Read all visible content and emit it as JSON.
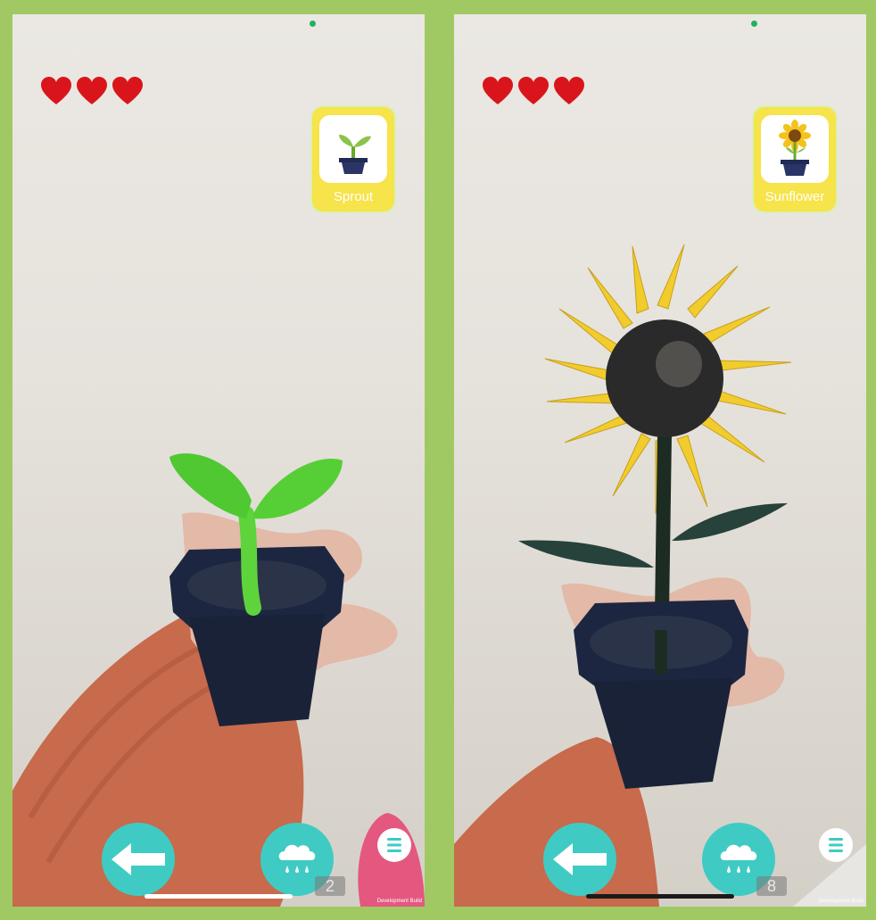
{
  "colors": {
    "background": "#a0c964",
    "heart": "#d9151b",
    "card": "#f7e34a",
    "button": "#3fcbc3"
  },
  "screens": [
    {
      "plant_card": {
        "label": "Sprout",
        "icon": "sprout-icon"
      },
      "hearts": [
        "heart-icon",
        "heart-icon",
        "heart-icon"
      ],
      "back_button": {
        "icon": "arrow-left-icon"
      },
      "water_button": {
        "icon": "rain-cloud-icon",
        "count": "2"
      },
      "menu_button": {
        "icon": "menu-icon"
      },
      "dev_label": "Development Build"
    },
    {
      "plant_card": {
        "label": "Sunflower",
        "icon": "sunflower-icon"
      },
      "hearts": [
        "heart-icon",
        "heart-icon",
        "heart-icon"
      ],
      "back_button": {
        "icon": "arrow-left-icon"
      },
      "water_button": {
        "icon": "rain-cloud-icon",
        "count": "8"
      },
      "menu_button": {
        "icon": "menu-icon"
      },
      "dev_label": "Development Build"
    }
  ]
}
